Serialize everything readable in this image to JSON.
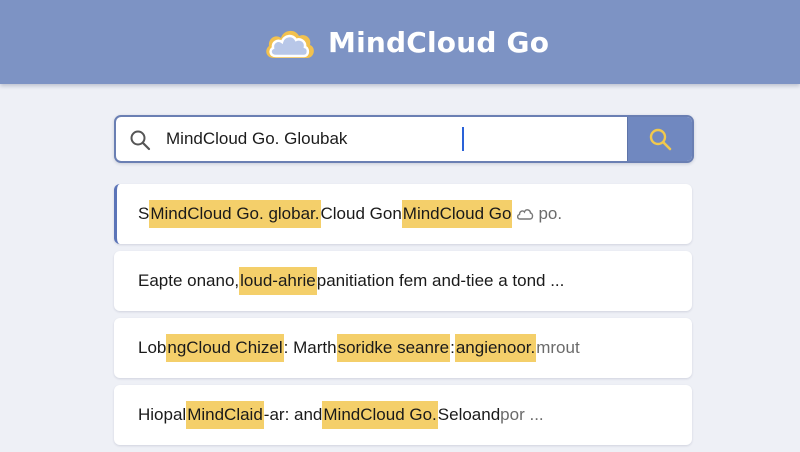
{
  "header": {
    "title": "MindCloud Go",
    "logo_icon": "cloud-logo-icon",
    "background_color": "#7d93c4"
  },
  "search": {
    "value": "MindCloud Go. Gloubak",
    "left_icon": "search-icon",
    "button_icon": "search-icon",
    "button_color": "#7088c0",
    "button_icon_color": "#f2c94c"
  },
  "results": [
    {
      "segments": [
        {
          "text": "S",
          "hl": false
        },
        {
          "text": "MindCloud Go. globar.",
          "hl": true
        },
        {
          "text": " Cloud Gon ",
          "hl": false
        },
        {
          "text": "MindCloud Go",
          "hl": true
        },
        {
          "text": " ",
          "hl": false
        },
        {
          "text": " po.",
          "hl": false,
          "muted": true
        }
      ],
      "has_cloud_icon": true,
      "active": true
    },
    {
      "segments": [
        {
          "text": "Eapte onano, ",
          "hl": false
        },
        {
          "text": "loud-ahrie",
          "hl": true
        },
        {
          "text": "panitiation fem and-tiee a tond   ...",
          "hl": false
        }
      ]
    },
    {
      "segments": [
        {
          "text": "Lob",
          "hl": false
        },
        {
          "text": "ngCloud Chizel",
          "hl": true
        },
        {
          "text": ": Marth ",
          "hl": false
        },
        {
          "text": "soridke seanre",
          "hl": true
        },
        {
          "text": ": ",
          "hl": false
        },
        {
          "text": "angienoor.",
          "hl": true
        },
        {
          "text": " mrout",
          "hl": false,
          "muted": true
        }
      ]
    },
    {
      "segments": [
        {
          "text": "Hiopal ",
          "hl": false
        },
        {
          "text": "MindClaid",
          "hl": true
        },
        {
          "text": "-ar: and",
          "hl": false
        },
        {
          "text": "MindCloud Go.",
          "hl": true
        },
        {
          "text": " Seloand ",
          "hl": false
        },
        {
          "text": "por  ...",
          "hl": false,
          "muted": true
        }
      ]
    }
  ],
  "colors": {
    "highlight": "#f4cf6a",
    "page_background": "#eef0f6"
  }
}
